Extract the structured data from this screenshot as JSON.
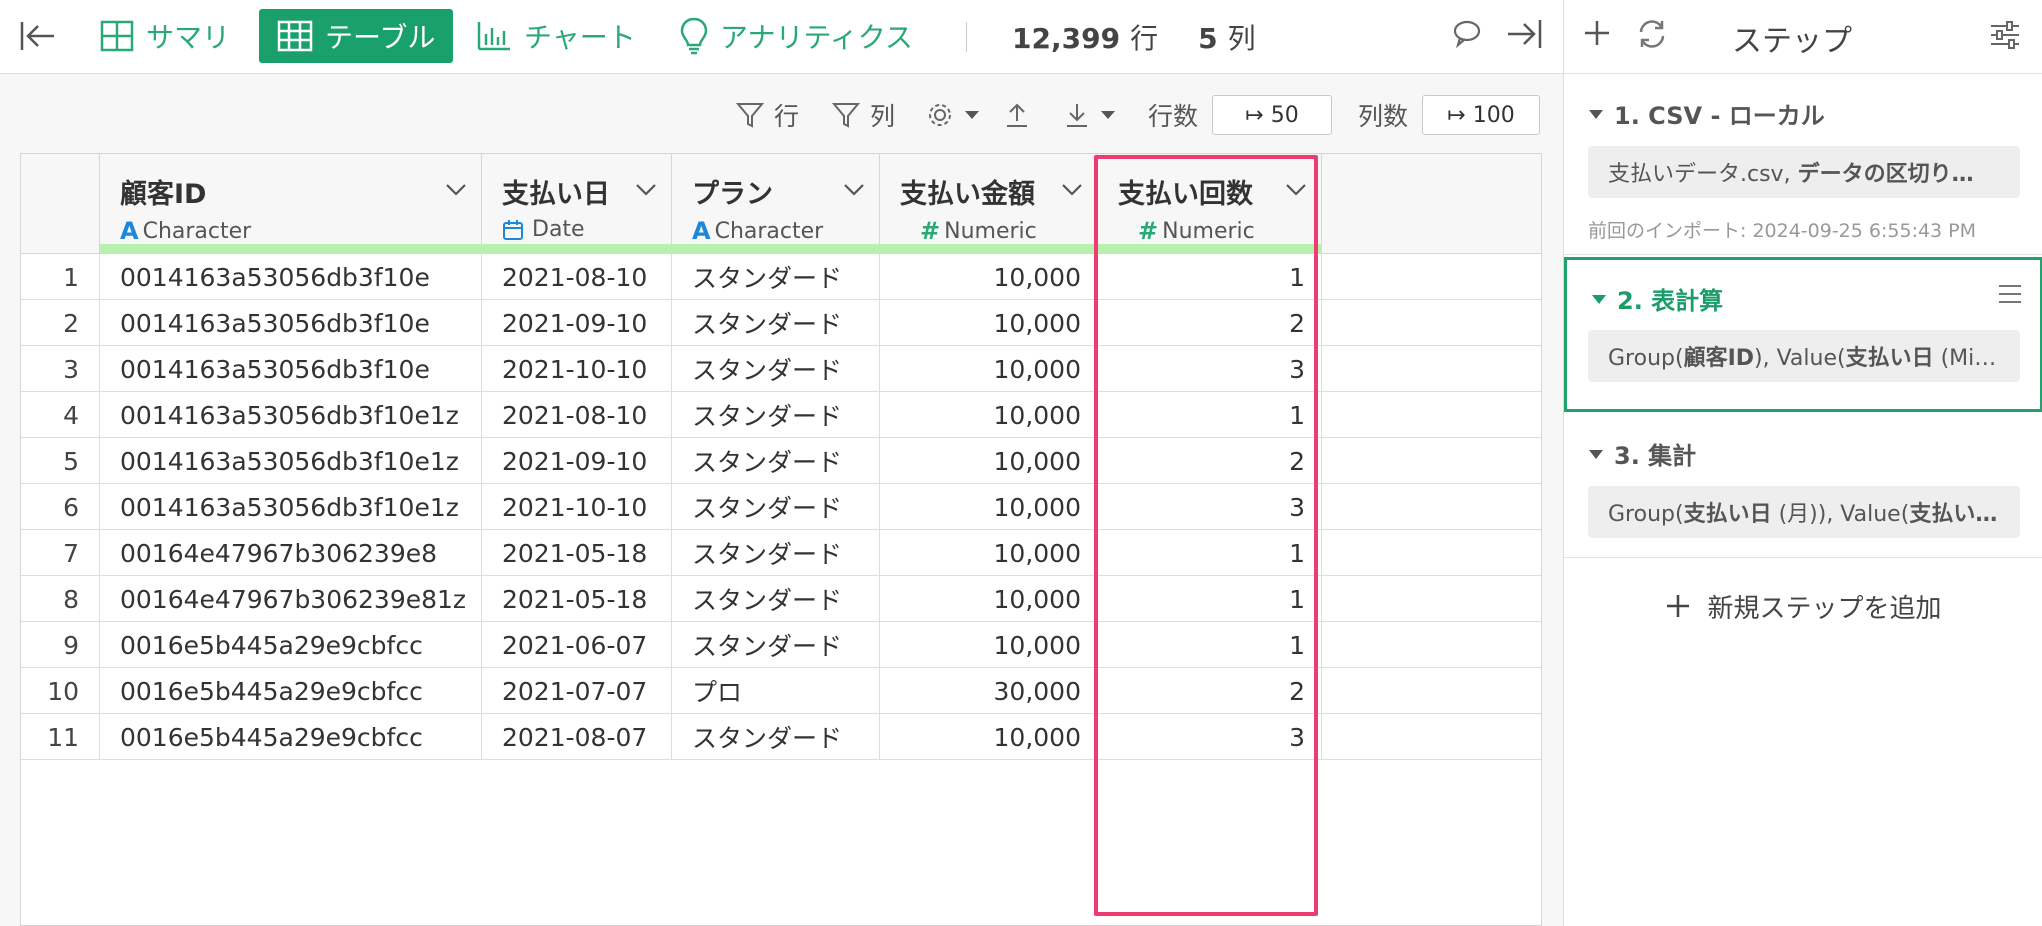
{
  "topbar": {
    "tabs": {
      "summary": "サマリ",
      "table": "テーブル",
      "chart": "チャート",
      "analytics": "アナリティクス"
    },
    "row_count": "12,399",
    "row_unit": "行",
    "col_count": "5",
    "col_unit": "列"
  },
  "toolbar": {
    "filter_rows": "行",
    "filter_cols": "列",
    "rows_label": "行数",
    "rows_value": "↦ 50",
    "cols_label": "列数",
    "cols_value": "↦ 100"
  },
  "table": {
    "columns": [
      {
        "name": "顧客ID",
        "type": "Character",
        "type_icon": "A"
      },
      {
        "name": "支払い日",
        "type": "Date",
        "type_icon": "calendar"
      },
      {
        "name": "プラン",
        "type": "Character",
        "type_icon": "A"
      },
      {
        "name": "支払い金額",
        "type": "Numeric",
        "type_icon": "#"
      },
      {
        "name": "支払い回数",
        "type": "Numeric",
        "type_icon": "#"
      }
    ],
    "rows": [
      [
        "1",
        "0014163a53056db3f10e",
        "2021-08-10",
        "スタンダード",
        "10,000",
        "1"
      ],
      [
        "2",
        "0014163a53056db3f10e",
        "2021-09-10",
        "スタンダード",
        "10,000",
        "2"
      ],
      [
        "3",
        "0014163a53056db3f10e",
        "2021-10-10",
        "スタンダード",
        "10,000",
        "3"
      ],
      [
        "4",
        "0014163a53056db3f10e1z",
        "2021-08-10",
        "スタンダード",
        "10,000",
        "1"
      ],
      [
        "5",
        "0014163a53056db3f10e1z",
        "2021-09-10",
        "スタンダード",
        "10,000",
        "2"
      ],
      [
        "6",
        "0014163a53056db3f10e1z",
        "2021-10-10",
        "スタンダード",
        "10,000",
        "3"
      ],
      [
        "7",
        "00164e47967b306239e8",
        "2021-05-18",
        "スタンダード",
        "10,000",
        "1"
      ],
      [
        "8",
        "00164e47967b306239e81z",
        "2021-05-18",
        "スタンダード",
        "10,000",
        "1"
      ],
      [
        "9",
        "0016e5b445a29e9cbfcc",
        "2021-06-07",
        "スタンダード",
        "10,000",
        "1"
      ],
      [
        "10",
        "0016e5b445a29e9cbfcc",
        "2021-07-07",
        "プロ",
        "30,000",
        "2"
      ],
      [
        "11",
        "0016e5b445a29e9cbfcc",
        "2021-08-07",
        "スタンダード",
        "10,000",
        "3"
      ]
    ]
  },
  "panel": {
    "title": "ステップ",
    "steps": [
      {
        "title": "1. CSV - ローカル",
        "body_plain": "支払いデータ.csv, ",
        "body_bold": "データの区切り…",
        "note": "前回のインポート: 2024-09-25 6:55:43 PM"
      },
      {
        "title": "2. 表計算",
        "body_a": "Group(",
        "body_b": "顧客ID",
        "body_c": "), Value(",
        "body_d": "支払い日",
        "body_e": " (Min…"
      },
      {
        "title": "3. 集計",
        "body_a": "Group(",
        "body_b": "支払い日",
        "body_c": " (月)), Value(",
        "body_d": "支払い…"
      }
    ],
    "add_step": "新規ステップを追加"
  },
  "colors": {
    "accent": "#19a06b",
    "highlight": "#ee3c72",
    "quality_bar": "#b8f0b0"
  }
}
